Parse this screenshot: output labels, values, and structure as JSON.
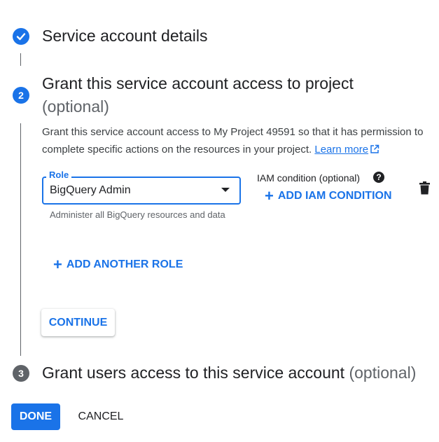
{
  "steps": [
    {
      "number": "",
      "title": "Service account details",
      "optional": "",
      "status": "complete"
    },
    {
      "number": "2",
      "title": "Grant this service account access to project",
      "optional": "(optional)",
      "status": "active"
    },
    {
      "number": "3",
      "title": "Grant users access to this service account",
      "optional": "(optional)",
      "status": "pending"
    }
  ],
  "grant_step": {
    "description": "Grant this service account access to My Project 49591 so that it has permission to complete specific actions on the resources in your project.",
    "learn_more": "Learn more",
    "role": {
      "label": "Role",
      "value": "BigQuery Admin",
      "hint": "Administer all BigQuery resources and data"
    },
    "iam_condition": {
      "label": "IAM condition (optional)",
      "add_label": "ADD IAM CONDITION"
    },
    "add_another_role": "ADD ANOTHER ROLE",
    "continue_label": "CONTINUE"
  },
  "footer": {
    "done_label": "DONE",
    "cancel_label": "CANCEL"
  },
  "colors": {
    "accent": "#1a73e8",
    "step_complete": "#1a73e8",
    "step_active": "#1a73e8",
    "step_pending": "#5f6368"
  }
}
